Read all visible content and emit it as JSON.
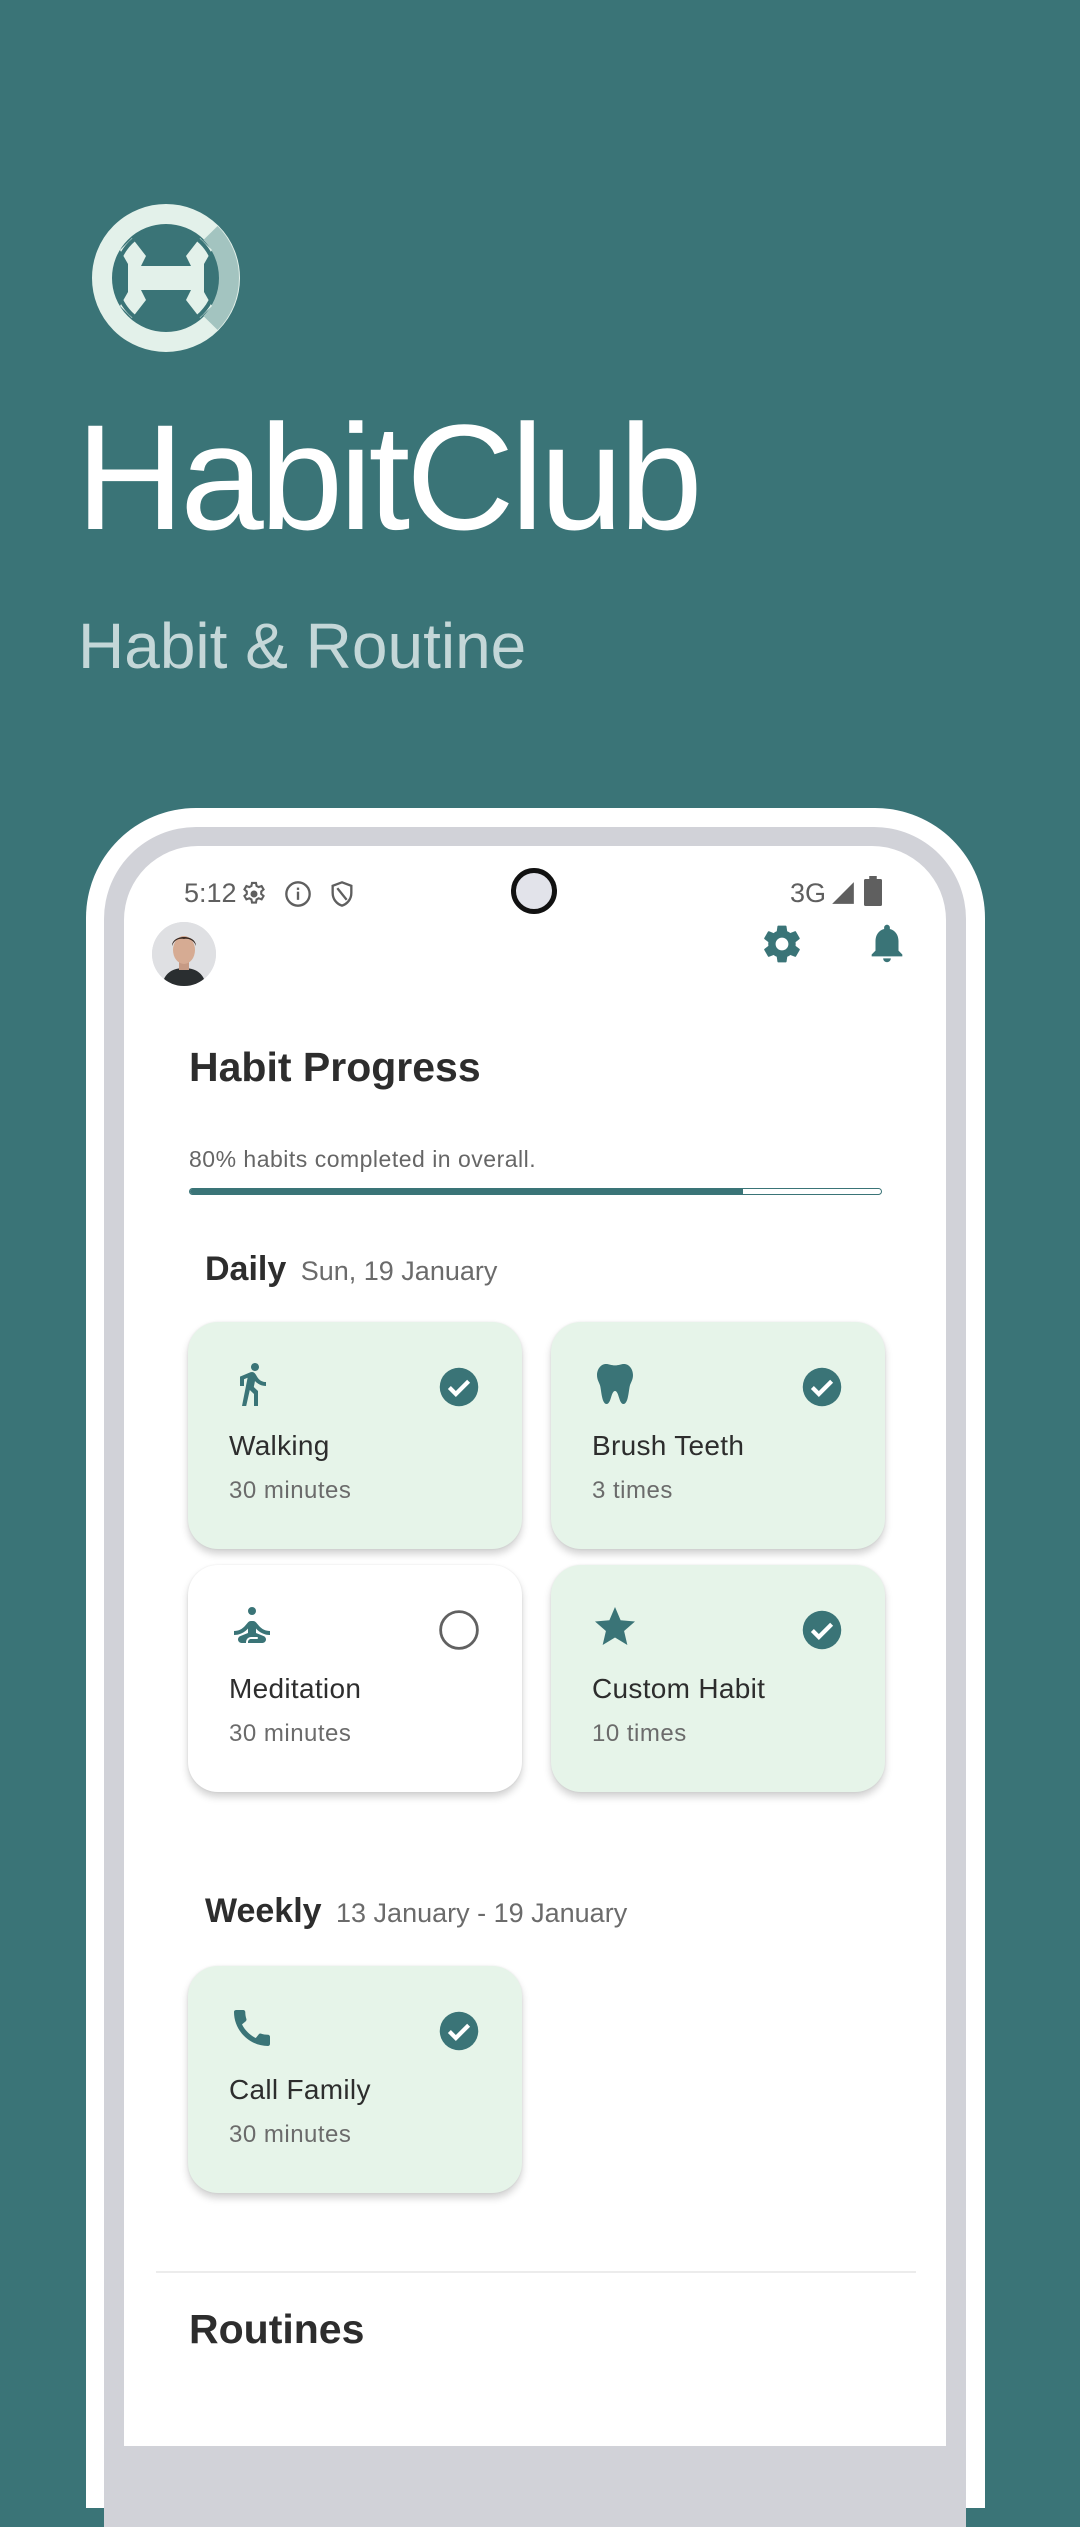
{
  "branding": {
    "app_name": "HabitClub",
    "tagline": "Habit & Routine",
    "logo_icon": "habitclub-logo-icon"
  },
  "colors": {
    "brand_teal": "#3a7477",
    "card_done_bg": "#e6f4e9",
    "card_todo_bg": "#ffffff",
    "bezel_gray": "#d1d2d8"
  },
  "status_bar": {
    "time": "5:12",
    "left_icons": [
      "settings-icon",
      "info-icon",
      "shield-icon"
    ],
    "network": "3G",
    "right_icons": [
      "signal-icon",
      "battery-icon"
    ]
  },
  "top_bar": {
    "avatar": "user-avatar",
    "actions": [
      "settings-icon",
      "notifications-bell-icon"
    ]
  },
  "progress": {
    "title": "Habit Progress",
    "summary": "80% habits completed in overall.",
    "percent": 80
  },
  "daily": {
    "title": "Daily",
    "date": "Sun, 19 January",
    "habits": [
      {
        "name": "Walking",
        "detail": "30 minutes",
        "icon": "walking-icon",
        "completed": true
      },
      {
        "name": "Brush Teeth",
        "detail": "3 times",
        "icon": "tooth-icon",
        "completed": true
      },
      {
        "name": "Meditation",
        "detail": "30 minutes",
        "icon": "meditation-icon",
        "completed": false
      },
      {
        "name": "Custom Habit",
        "detail": "10 times",
        "icon": "star-icon",
        "completed": true
      }
    ]
  },
  "weekly": {
    "title": "Weekly",
    "date_range": "13 January - 19 January",
    "habits": [
      {
        "name": "Call Family",
        "detail": "30 minutes",
        "icon": "phone-icon",
        "completed": true
      }
    ]
  },
  "routines": {
    "title": "Routines"
  }
}
